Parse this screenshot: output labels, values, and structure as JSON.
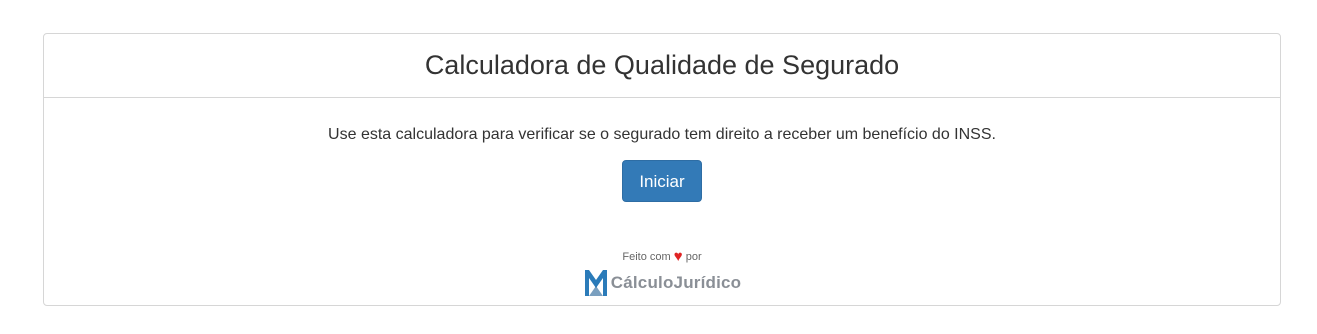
{
  "calculator": {
    "title": "Calculadora de Qualidade de Segurado",
    "description": "Use esta calculadora para verificar se o segurado tem direito a receber um benefício do INSS.",
    "start_button_label": "Iniciar"
  },
  "footer": {
    "made_with_prefix": "Feito com",
    "heart_icon": "heart-icon",
    "heart_color": "#e02424",
    "made_with_suffix": "por",
    "brand_name": "CálculoJurídico",
    "brand_color": "#2b7bb9"
  },
  "colors": {
    "primary_button": "#337ab7",
    "border": "#d6d6d6",
    "text": "#333333"
  }
}
